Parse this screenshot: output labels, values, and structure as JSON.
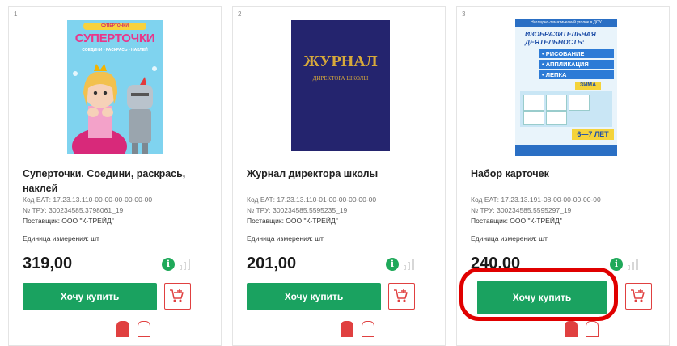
{
  "products": [
    {
      "index": "1",
      "cover_text": {
        "banner": "СУПЕРТОЧКИ",
        "title": "СУПЕРТОЧКИ",
        "subtitle": "СОЕДИНИ • РАСКРАСЬ • НАКЛЕЙ"
      },
      "title": "Суперточки. Соедини, раскрась, наклей",
      "code": "Код ЕАТ: 17.23.13.110-00-00-00-00-00-00",
      "tru": "№ ТРУ: 300234585.3798061_19",
      "supplier": "Поставщик: ООО \"К-ТРЕЙД\"",
      "unit": "Единица измерения: шт",
      "price": "319,00",
      "buy_label": "Хочу купить"
    },
    {
      "index": "2",
      "cover_text": {
        "title": "ЖУРНАЛ",
        "subtitle": "ДИРЕКТОРА ШКОЛЫ"
      },
      "title": "Журнал директора школы",
      "code": "Код ЕАТ: 17.23.13.110-01-00-00-00-00-00",
      "tru": "№ ТРУ: 300234585.5595235_19",
      "supplier": "Поставщик: ООО \"К-ТРЕЙД\"",
      "unit": "Единица измерения: шт",
      "price": "201,00",
      "buy_label": "Хочу купить"
    },
    {
      "index": "3",
      "cover_text": {
        "banner": "Наглядно-тематический уголок в ДОУ",
        "title": "ИЗОБРАЗИТЕЛЬНАЯ ДЕЯТЕЛЬНОСТЬ:",
        "items": [
          "• РИСОВАНИЕ",
          "• АППЛИКАЦИЯ",
          "• ЛЕПКА"
        ],
        "season": "ЗИМА",
        "age": "6—7 ЛЕТ"
      },
      "title": "Набор карточек",
      "code": "Код ЕАТ: 17.23.13.191-08-00-00-00-00-00",
      "tru": "№ ТРУ: 300234585.5595297_19",
      "supplier": "Поставщик: ООО \"К-ТРЕЙД\"",
      "unit": "Единица измерения: шт",
      "price": "240,00",
      "buy_label": "Хочу купить"
    }
  ],
  "icons": {
    "info": "info-icon",
    "stats": "bar-chart-icon",
    "cart": "add-to-cart-icon"
  },
  "colors": {
    "buy_button": "#1aa260",
    "info_badge": "#1fa95a",
    "cart_outline": "#e04040",
    "highlight": "#e00000",
    "journal_cover": "#24246e"
  },
  "info_glyph": "i"
}
